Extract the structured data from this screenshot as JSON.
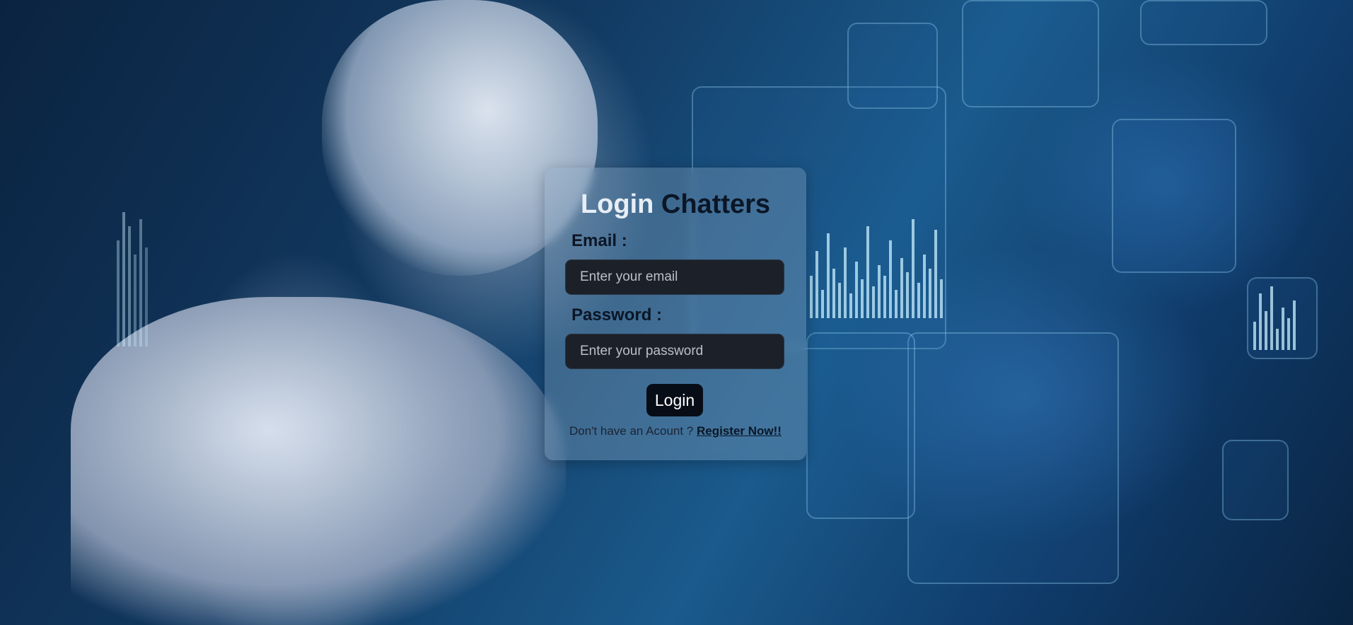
{
  "login_card": {
    "title_part1": "Login",
    "title_part2": "Chatters",
    "email_label": "Email :",
    "email_placeholder": "Enter your email",
    "email_value": "",
    "password_label": "Password :",
    "password_placeholder": "Enter your password",
    "password_value": "",
    "login_button": "Login",
    "register_prompt": "Don't have an Acount ?",
    "register_link": "Register Now!!"
  },
  "colors": {
    "accent_dark": "#0b1626",
    "input_bg": "#1c2129",
    "button_bg": "#070d16",
    "title_light": "#e8eef6"
  }
}
